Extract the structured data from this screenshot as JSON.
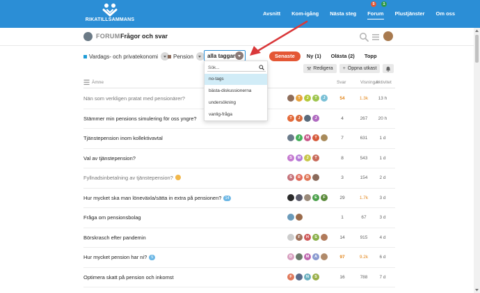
{
  "brand": {
    "name": "RIKATILLSAMMANS"
  },
  "nav": {
    "links": [
      "Avsnitt",
      "Kom-igång",
      "Nästa steg",
      "Forum",
      "Plustjänster",
      "Om oss"
    ],
    "active": "Forum"
  },
  "header": {
    "forum_word": "FORUM",
    "title": "Frågor och svar",
    "notifications_red": "5",
    "notifications_green": "1"
  },
  "filters": {
    "category1": {
      "label": "Vardags- och privatekonomi",
      "color": "#1e9cd6"
    },
    "category2": {
      "label": "Pension",
      "color": "#8a6a5a"
    },
    "tag_selected": "alla taggar"
  },
  "tabs": [
    {
      "label": "Senaste",
      "active": true
    },
    {
      "label": "Ny (1)",
      "active": false
    },
    {
      "label": "Olästa (2)",
      "active": false
    },
    {
      "label": "Topp",
      "active": false
    }
  ],
  "actions": {
    "edit": "Redigera",
    "new_draft": "Öppna utkast"
  },
  "dropdown": {
    "placeholder": "Sök...",
    "items": [
      "no-tags",
      "bästa-diskussionerna",
      "undersökning",
      "vanlig-fråga"
    ],
    "highlighted": "no-tags"
  },
  "list_header": {
    "topic": "Ämne",
    "replies": "Svar",
    "views": "Visningar",
    "activity": "Aktivitet"
  },
  "topics": [
    {
      "title": "Nän som verkligen pratat med pensionärer?",
      "read": true,
      "badge": "",
      "emoji": false,
      "avatars": [
        {
          "l": "",
          "c": "#8e6d5a"
        },
        {
          "l": "T",
          "c": "#e8a33d"
        },
        {
          "l": "J",
          "c": "#b5c93a"
        },
        {
          "l": "T",
          "c": "#9ec54f"
        },
        {
          "l": "J",
          "c": "#7ac0d6"
        }
      ],
      "replies": "54",
      "replies_hot": true,
      "views": "1.3k",
      "views_hot": true,
      "activity": "13 h"
    },
    {
      "title": "Stämmer min pensions simulering för oss yngre?",
      "read": false,
      "badge": "",
      "emoji": false,
      "avatars": [
        {
          "l": "T",
          "c": "#e46a3a"
        },
        {
          "l": "J",
          "c": "#d8683b"
        },
        {
          "l": "",
          "c": "#5a6a7a"
        },
        {
          "l": "J",
          "c": "#b06ac0"
        }
      ],
      "replies": "4",
      "replies_hot": false,
      "views": "267",
      "views_hot": false,
      "activity": "20 h"
    },
    {
      "title": "Tjänstepension inom kollektivavtal",
      "read": false,
      "badge": "",
      "emoji": false,
      "avatars": [
        {
          "l": "",
          "c": "#6a7a8a"
        },
        {
          "l": "J",
          "c": "#45b05a"
        },
        {
          "l": "M",
          "c": "#c95a8a"
        },
        {
          "l": "T",
          "c": "#d65a3a"
        },
        {
          "l": "",
          "c": "#a88a5a"
        }
      ],
      "replies": "7",
      "replies_hot": false,
      "views": "631",
      "views_hot": false,
      "activity": "1 d"
    },
    {
      "title": "Val av tjänstepension?",
      "read": false,
      "badge": "",
      "emoji": false,
      "avatars": [
        {
          "l": "S",
          "c": "#c57ad0"
        },
        {
          "l": "M",
          "c": "#b57ad8"
        },
        {
          "l": "J",
          "c": "#c8c84a"
        },
        {
          "l": "T",
          "c": "#c86a5a"
        }
      ],
      "replies": "8",
      "replies_hot": false,
      "views": "543",
      "views_hot": false,
      "activity": "1 d"
    },
    {
      "title": "Fyllnadsinbetalning av tjänstepension?",
      "read": true,
      "badge": "",
      "emoji": true,
      "avatars": [
        {
          "l": "S",
          "c": "#c5727a"
        },
        {
          "l": "R",
          "c": "#e06a5a"
        },
        {
          "l": "R",
          "c": "#e0785a"
        },
        {
          "l": "",
          "c": "#8a6a5a"
        }
      ],
      "replies": "3",
      "replies_hot": false,
      "views": "154",
      "views_hot": false,
      "activity": "2 d"
    },
    {
      "title": "Hur mycket ska man löneväxla/sätta in extra på pensionen?",
      "read": false,
      "badge": "14",
      "emoji": false,
      "avatars": [
        {
          "l": "",
          "c": "#2a2a2a"
        },
        {
          "l": "",
          "c": "#5a5a6a"
        },
        {
          "l": "",
          "c": "#9a8a7a"
        },
        {
          "l": "E",
          "c": "#4aa04a"
        },
        {
          "l": "F",
          "c": "#5a8a3a"
        }
      ],
      "replies": "29",
      "replies_hot": false,
      "views": "1.7k",
      "views_hot": true,
      "activity": "3 d"
    },
    {
      "title": "Fråga om pensionsbolag",
      "read": false,
      "badge": "",
      "emoji": false,
      "avatars": [
        {
          "l": "",
          "c": "#6a9aba"
        },
        {
          "l": "",
          "c": "#9a6a4a"
        }
      ],
      "replies": "1",
      "replies_hot": false,
      "views": "67",
      "views_hot": false,
      "activity": "3 d"
    },
    {
      "title": "Börskrasch efter pandemin",
      "read": false,
      "badge": "",
      "emoji": false,
      "avatars": [
        {
          "l": "",
          "c": "#cccccc"
        },
        {
          "l": "F",
          "c": "#a0705a"
        },
        {
          "l": "H",
          "c": "#d05a5a"
        },
        {
          "l": "S",
          "c": "#8ab04a"
        },
        {
          "l": "",
          "c": "#b07a5a"
        }
      ],
      "replies": "14",
      "replies_hot": false,
      "views": "915",
      "views_hot": false,
      "activity": "4 d"
    },
    {
      "title": "Hur mycket pension har ni?",
      "read": false,
      "badge": "5",
      "emoji": false,
      "avatars": [
        {
          "l": "D",
          "c": "#d8a0c0"
        },
        {
          "l": "",
          "c": "#6a7a6a"
        },
        {
          "l": "M",
          "c": "#c06ab0"
        },
        {
          "l": "A",
          "c": "#8a9ad0"
        },
        {
          "l": "",
          "c": "#b08a6a"
        }
      ],
      "replies": "97",
      "replies_hot": true,
      "views": "9.2k",
      "views_hot": true,
      "activity": "6 d"
    },
    {
      "title": "Optimera skatt på pension och inkomst",
      "read": false,
      "badge": "",
      "emoji": false,
      "avatars": [
        {
          "l": "F",
          "c": "#e0785a"
        },
        {
          "l": "",
          "c": "#5a6a8a"
        },
        {
          "l": "N",
          "c": "#6ab0c0"
        },
        {
          "l": "S",
          "c": "#9ab04a"
        }
      ],
      "replies": "16",
      "replies_hot": false,
      "views": "788",
      "views_hot": false,
      "activity": "7 d"
    }
  ]
}
